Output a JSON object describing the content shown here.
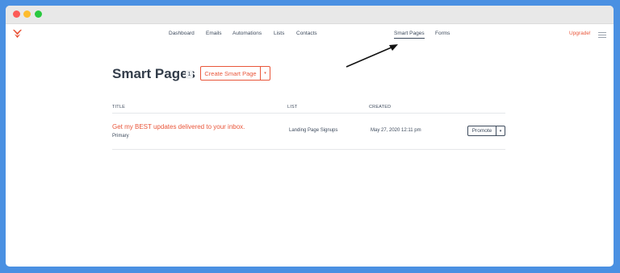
{
  "nav": {
    "items": [
      "Dashboard",
      "Emails",
      "Automations",
      "Lists",
      "Contacts",
      "Smart Pages",
      "Forms"
    ],
    "upgrade": "Upgrade!",
    "active": "Smart Pages"
  },
  "page": {
    "title": "Smart Pages",
    "count": "1",
    "create_button": "Create Smart Page",
    "caret": "▾"
  },
  "table": {
    "headers": [
      "TITLE",
      "LIST",
      "CREATED"
    ],
    "rows": [
      {
        "title": "Get my BEST updates delivered to your inbox.",
        "subtitle": "Primary",
        "list": "Landing Page Signups",
        "created": "May 27, 2020 12:11 pm",
        "action": "Promote"
      }
    ]
  },
  "colors": {
    "accent": "#e9563a",
    "text": "#3d4a5c",
    "background": "#4a90e2"
  },
  "icons": [
    "logo-icon",
    "menu-icon",
    "caret-down-icon",
    "annotation-arrow-icon"
  ]
}
